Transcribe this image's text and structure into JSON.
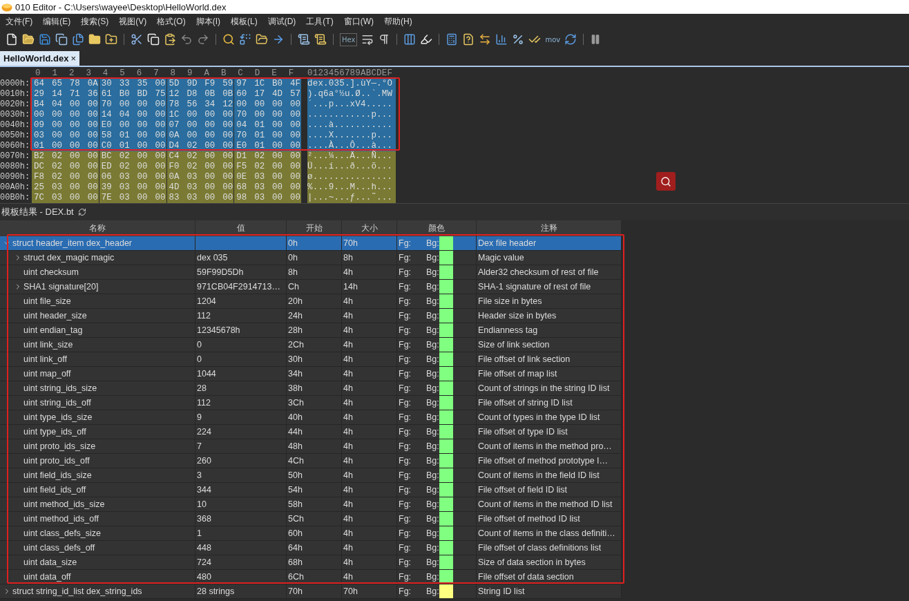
{
  "window": {
    "title": "010 Editor - C:\\Users\\wayee\\Desktop\\HelloWorld.dex"
  },
  "menu": [
    "文件(F)",
    "编辑(E)",
    "搜索(S)",
    "视图(V)",
    "格式(O)",
    "脚本(I)",
    "模板(L)",
    "调试(D)",
    "工具(T)",
    "窗口(W)",
    "帮助(H)"
  ],
  "toolbar": {
    "hex_label": "Hex",
    "mov_label": "mov"
  },
  "tabs": [
    {
      "label": "HelloWorld.dex",
      "close": "×",
      "selected": true
    }
  ],
  "hex": {
    "columns": [
      "0",
      "1",
      "2",
      "3",
      "4",
      "5",
      "6",
      "7",
      "8",
      "9",
      "A",
      "B",
      "C",
      "D",
      "E",
      "F"
    ],
    "ascii_header": "0123456789ABCDEF",
    "rows": [
      {
        "offset": "0000h:",
        "groups": [
          "64 65 78 0A",
          "30 33 35 00",
          "5D 9D F9 59",
          "97 1C B0 4F"
        ],
        "ascii": "dex.035.].ùY—.°O",
        "selected": true
      },
      {
        "offset": "0010h:",
        "groups": [
          "29 14 71 36",
          "61 B0 BD 75",
          "12 D8 0B 0B",
          "60 17 4D 57"
        ],
        "ascii": ").q6a°½u.Ø..`.MW",
        "selected": true
      },
      {
        "offset": "0020h:",
        "groups": [
          "B4 04 00 00",
          "70 00 00 00",
          "78 56 34 12",
          "00 00 00 00"
        ],
        "ascii": "´...p...xV4.....",
        "selected": true
      },
      {
        "offset": "0030h:",
        "groups": [
          "00 00 00 00",
          "14 04 00 00",
          "1C 00 00 00",
          "70 00 00 00"
        ],
        "ascii": "............p...",
        "selected": true
      },
      {
        "offset": "0040h:",
        "groups": [
          "09 00 00 00",
          "E0 00 00 00",
          "07 00 00 00",
          "04 01 00 00"
        ],
        "ascii": "....à...........",
        "selected": true
      },
      {
        "offset": "0050h:",
        "groups": [
          "03 00 00 00",
          "58 01 00 00",
          "0A 00 00 00",
          "70 01 00 00"
        ],
        "ascii": "....X.......p...",
        "selected": true
      },
      {
        "offset": "0060h:",
        "groups": [
          "01 00 00 00",
          "C0 01 00 00",
          "D4 02 00 00",
          "E0 01 00 00"
        ],
        "ascii": "....À...Ô...à...",
        "selected": true
      },
      {
        "offset": "0070h:",
        "groups": [
          "B2 02 00 00",
          "BC 02 00 00",
          "C4 02 00 00",
          "D1 02 00 00"
        ],
        "ascii": "²...¼...Ä...Ñ...",
        "selected": false
      },
      {
        "offset": "0080h:",
        "groups": [
          "DC 02 00 00",
          "ED 02 00 00",
          "F0 02 00 00",
          "F5 02 00 00"
        ],
        "ascii": "Ü...í...ð...õ...",
        "selected": false
      },
      {
        "offset": "0090h:",
        "groups": [
          "F8 02 00 00",
          "06 03 00 00",
          "0A 03 00 00",
          "0E 03 00 00"
        ],
        "ascii": "ø...............",
        "selected": false
      },
      {
        "offset": "00A0h:",
        "groups": [
          "25 03 00 00",
          "39 03 00 00",
          "4D 03 00 00",
          "68 03 00 00"
        ],
        "ascii": "%...9...M...h...",
        "selected": false
      },
      {
        "offset": "00B0h:",
        "groups": [
          "7C 03 00 00",
          "7E 03 00 00",
          "83 03 00 00",
          "98 03 00 00"
        ],
        "ascii": "|...~...ƒ...˜...",
        "selected": false
      }
    ]
  },
  "template": {
    "title": "模板结果 - DEX.bt",
    "columns": [
      "名称",
      "值",
      "开始",
      "大小",
      "颜色",
      "注释"
    ],
    "rows": [
      {
        "name": "struct header_item dex_header",
        "value": "",
        "start": "0h",
        "size": "70h",
        "fg": "Fg:",
        "bg": "Bg:",
        "color": "#80ff80",
        "comment": "Dex file header",
        "expandable": true,
        "expanded": true,
        "selected": true,
        "children": [
          {
            "name": "struct dex_magic magic",
            "value": "dex 035",
            "start": "0h",
            "size": "8h",
            "fg": "Fg:",
            "bg": "Bg:",
            "color": "#80ff80",
            "comment": "Magic value",
            "expandable": true,
            "expanded": false,
            "selected": false
          },
          {
            "name": "uint checksum",
            "value": "59F99D5Dh",
            "start": "8h",
            "size": "4h",
            "fg": "Fg:",
            "bg": "Bg:",
            "color": "#80ff80",
            "comment": "Alder32 checksum of rest of file",
            "expandable": false,
            "expanded": false,
            "selected": false
          },
          {
            "name": "SHA1 signature[20]",
            "value": "971CB04F2914713…",
            "start": "Ch",
            "size": "14h",
            "fg": "Fg:",
            "bg": "Bg:",
            "color": "#80ff80",
            "comment": "SHA-1 signature of rest of file",
            "expandable": true,
            "expanded": false,
            "selected": false
          },
          {
            "name": "uint file_size",
            "value": "1204",
            "start": "20h",
            "size": "4h",
            "fg": "Fg:",
            "bg": "Bg:",
            "color": "#80ff80",
            "comment": "File size in bytes",
            "expandable": false,
            "expanded": false,
            "selected": false
          },
          {
            "name": "uint header_size",
            "value": "112",
            "start": "24h",
            "size": "4h",
            "fg": "Fg:",
            "bg": "Bg:",
            "color": "#80ff80",
            "comment": "Header size in bytes",
            "expandable": false,
            "expanded": false,
            "selected": false
          },
          {
            "name": "uint endian_tag",
            "value": "12345678h",
            "start": "28h",
            "size": "4h",
            "fg": "Fg:",
            "bg": "Bg:",
            "color": "#80ff80",
            "comment": "Endianness tag",
            "expandable": false,
            "expanded": false,
            "selected": false
          },
          {
            "name": "uint link_size",
            "value": "0",
            "start": "2Ch",
            "size": "4h",
            "fg": "Fg:",
            "bg": "Bg:",
            "color": "#80ff80",
            "comment": "Size of link section",
            "expandable": false,
            "expanded": false,
            "selected": false
          },
          {
            "name": "uint link_off",
            "value": "0",
            "start": "30h",
            "size": "4h",
            "fg": "Fg:",
            "bg": "Bg:",
            "color": "#80ff80",
            "comment": "File offset of link section",
            "expandable": false,
            "expanded": false,
            "selected": false
          },
          {
            "name": "uint map_off",
            "value": "1044",
            "start": "34h",
            "size": "4h",
            "fg": "Fg:",
            "bg": "Bg:",
            "color": "#80ff80",
            "comment": "File offset of map list",
            "expandable": false,
            "expanded": false,
            "selected": false
          },
          {
            "name": "uint string_ids_size",
            "value": "28",
            "start": "38h",
            "size": "4h",
            "fg": "Fg:",
            "bg": "Bg:",
            "color": "#80ff80",
            "comment": "Count of strings in the string ID list",
            "expandable": false,
            "expanded": false,
            "selected": false
          },
          {
            "name": "uint string_ids_off",
            "value": "112",
            "start": "3Ch",
            "size": "4h",
            "fg": "Fg:",
            "bg": "Bg:",
            "color": "#80ff80",
            "comment": "File offset of string ID list",
            "expandable": false,
            "expanded": false,
            "selected": false
          },
          {
            "name": "uint type_ids_size",
            "value": "9",
            "start": "40h",
            "size": "4h",
            "fg": "Fg:",
            "bg": "Bg:",
            "color": "#80ff80",
            "comment": "Count of types in the type ID list",
            "expandable": false,
            "expanded": false,
            "selected": false
          },
          {
            "name": "uint type_ids_off",
            "value": "224",
            "start": "44h",
            "size": "4h",
            "fg": "Fg:",
            "bg": "Bg:",
            "color": "#80ff80",
            "comment": "File offset of type ID list",
            "expandable": false,
            "expanded": false,
            "selected": false
          },
          {
            "name": "uint proto_ids_size",
            "value": "7",
            "start": "48h",
            "size": "4h",
            "fg": "Fg:",
            "bg": "Bg:",
            "color": "#80ff80",
            "comment": "Count of items in the method pro…",
            "expandable": false,
            "expanded": false,
            "selected": false
          },
          {
            "name": "uint proto_ids_off",
            "value": "260",
            "start": "4Ch",
            "size": "4h",
            "fg": "Fg:",
            "bg": "Bg:",
            "color": "#80ff80",
            "comment": "File offset of method prototype I…",
            "expandable": false,
            "expanded": false,
            "selected": false
          },
          {
            "name": "uint field_ids_size",
            "value": "3",
            "start": "50h",
            "size": "4h",
            "fg": "Fg:",
            "bg": "Bg:",
            "color": "#80ff80",
            "comment": "Count of items in the field ID list",
            "expandable": false,
            "expanded": false,
            "selected": false
          },
          {
            "name": "uint field_ids_off",
            "value": "344",
            "start": "54h",
            "size": "4h",
            "fg": "Fg:",
            "bg": "Bg:",
            "color": "#80ff80",
            "comment": "File offset of field ID list",
            "expandable": false,
            "expanded": false,
            "selected": false
          },
          {
            "name": "uint method_ids_size",
            "value": "10",
            "start": "58h",
            "size": "4h",
            "fg": "Fg:",
            "bg": "Bg:",
            "color": "#80ff80",
            "comment": "Count of items in the method ID list",
            "expandable": false,
            "expanded": false,
            "selected": false
          },
          {
            "name": "uint method_ids_off",
            "value": "368",
            "start": "5Ch",
            "size": "4h",
            "fg": "Fg:",
            "bg": "Bg:",
            "color": "#80ff80",
            "comment": "File offset of method ID list",
            "expandable": false,
            "expanded": false,
            "selected": false
          },
          {
            "name": "uint class_defs_size",
            "value": "1",
            "start": "60h",
            "size": "4h",
            "fg": "Fg:",
            "bg": "Bg:",
            "color": "#80ff80",
            "comment": "Count of items in the class definiti…",
            "expandable": false,
            "expanded": false,
            "selected": false
          },
          {
            "name": "uint class_defs_off",
            "value": "448",
            "start": "64h",
            "size": "4h",
            "fg": "Fg:",
            "bg": "Bg:",
            "color": "#80ff80",
            "comment": "File offset of class definitions list",
            "expandable": false,
            "expanded": false,
            "selected": false
          },
          {
            "name": "uint data_size",
            "value": "724",
            "start": "68h",
            "size": "4h",
            "fg": "Fg:",
            "bg": "Bg:",
            "color": "#80ff80",
            "comment": "Size of data section in bytes",
            "expandable": false,
            "expanded": false,
            "selected": false
          },
          {
            "name": "uint data_off",
            "value": "480",
            "start": "6Ch",
            "size": "4h",
            "fg": "Fg:",
            "bg": "Bg:",
            "color": "#80ff80",
            "comment": "File offset of data section",
            "expandable": false,
            "expanded": false,
            "selected": false
          }
        ]
      },
      {
        "name": "struct string_id_list dex_string_ids",
        "value": "28 strings",
        "start": "70h",
        "size": "70h",
        "fg": "Fg:",
        "bg": "Bg:",
        "color": "#ffff80",
        "comment": "String ID list",
        "expandable": true,
        "expanded": false,
        "selected": false
      }
    ]
  }
}
